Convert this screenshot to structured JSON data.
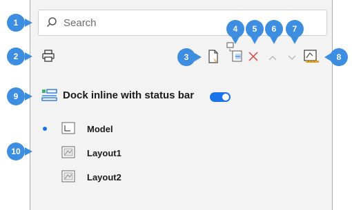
{
  "search": {
    "placeholder": "Search",
    "icon": "search-icon"
  },
  "toolbar": {
    "left_tool_icon": "print-icon",
    "tools": [
      "new-layout-icon",
      "copy-layout-icon",
      "delete-icon",
      "move-up-icon",
      "move-down-icon",
      "page-setup-icon"
    ]
  },
  "dock": {
    "label": "Dock inline with status bar",
    "toggle_on": true,
    "icon": "dock-status-bar-icon"
  },
  "layouts": [
    {
      "label": "Model",
      "current": true,
      "icon": "model-space-icon"
    },
    {
      "label": "Layout1",
      "current": false,
      "icon": "layout-sheet-icon"
    },
    {
      "label": "Layout2",
      "current": false,
      "icon": "layout-sheet-icon"
    }
  ],
  "callouts": [
    "1",
    "2",
    "3",
    "4",
    "5",
    "6",
    "7",
    "8",
    "9",
    "10"
  ],
  "colors": {
    "accent": "#1a73e8",
    "callout": "#3d8de0",
    "delete": "#e05050",
    "panel_bg": "#f3f3f3"
  }
}
